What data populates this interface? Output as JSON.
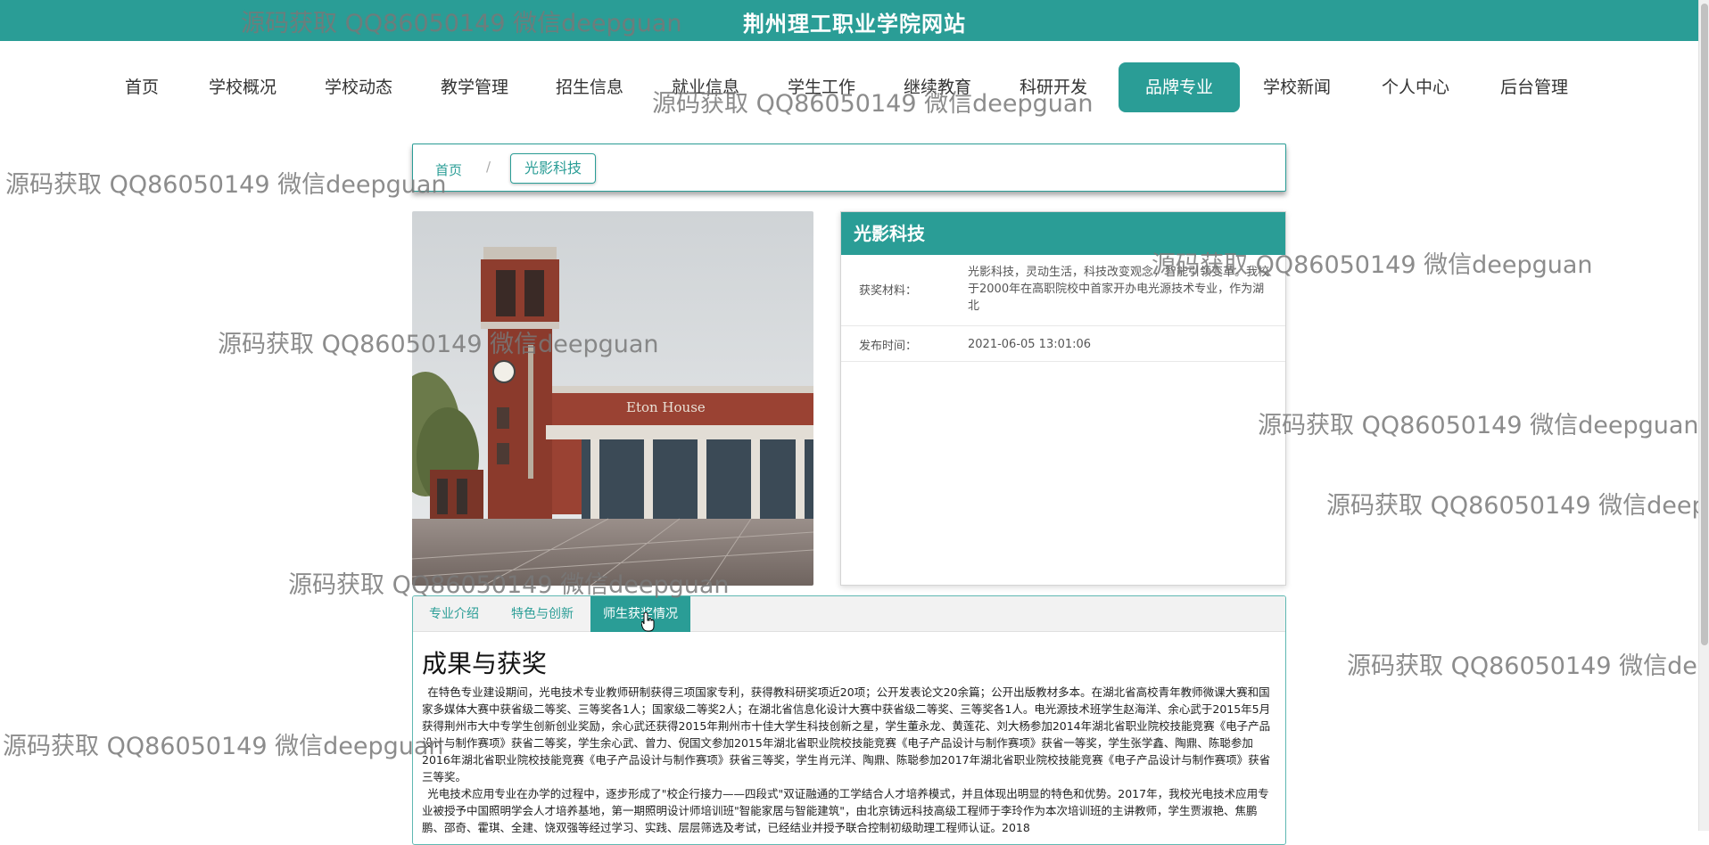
{
  "site_title": "荆州理工职业学院网站",
  "nav": [
    "首页",
    "学校概况",
    "学校动态",
    "教学管理",
    "招生信息",
    "就业信息",
    "学生工作",
    "继续教育",
    "科研开发",
    "品牌专业",
    "学校新闻",
    "个人中心",
    "后台管理"
  ],
  "nav_active": "品牌专业",
  "breadcrumb": {
    "home": "首页",
    "separator": "/",
    "current": "光影科技"
  },
  "detail": {
    "title": "光影科技",
    "award_label": "获奖材料：",
    "award_value": "光影科技，灵动生活，科技改变观念，智能引领变革。我校于2000年在高职院校中首家开办电光源技术专业，作为湖北",
    "time_label": "发布时间：",
    "time_value": "2021-06-05 13:01:06"
  },
  "tabs": [
    "专业介绍",
    "特色与创新",
    "师生获奖情况"
  ],
  "active_tab": "师生获奖情况",
  "section": {
    "heading": "成果与获奖",
    "paragraph1": "在特色专业建设期间，光电技术专业教师研制获得三项国家专利，获得教科研奖项近20项；公开发表论文20余篇；公开出版教材多本。在湖北省高校青年教师微课大赛和国家多媒体大赛中获省级二等奖、三等奖各1人；国家级二等奖2人；在湖北省信息化设计大赛中获省级二等奖、三等奖各1人。电光源技术班学生赵海洋、余心武于2015年5月获得荆州市大中专学生创新创业奖励，余心武还获得2015年荆州市十佳大学生科技创新之星，学生董永龙、黄莲花、刘大杨参加2014年湖北省职业院校技能竞赛《电子产品设计与制作赛项》获省二等奖，学生余心武、曾力、倪国文参加2015年湖北省职业院校技能竞赛《电子产品设计与制作赛项》获省一等奖，学生张学鑫、陶鼎、陈聪参加2016年湖北省职业院校技能竞赛《电子产品设计与制作赛项》获省三等奖，学生肖元洋、陶鼎、陈聪参加2017年湖北省职业院校技能竞赛《电子产品设计与制作赛项》获省三等奖。",
    "paragraph2": "光电技术应用专业在办学的过程中，逐步形成了\"校企行接力——四段式\"双证融通的工学结合人才培养模式，并且体现出明显的特色和优势。2017年，我校光电技术应用专业被授予中国照明学会人才培养基地，第一期照明设计师培训班\"智能家居与智能建筑\"，由北京铸远科技高级工程师于李玲作为本次培训班的主讲教师，学生贾淑艳、焦鹏鹏、邵奇、霍琪、全建、饶双强等经过学习、实践、层层筛选及考试，已经结业并授予联合控制初级助理工程师认证。2018"
  },
  "building_sign": "Eton House",
  "watermark": "源码获取 QQ86050149 微信deepguan",
  "colors": {
    "accent": "#2a9d96"
  }
}
